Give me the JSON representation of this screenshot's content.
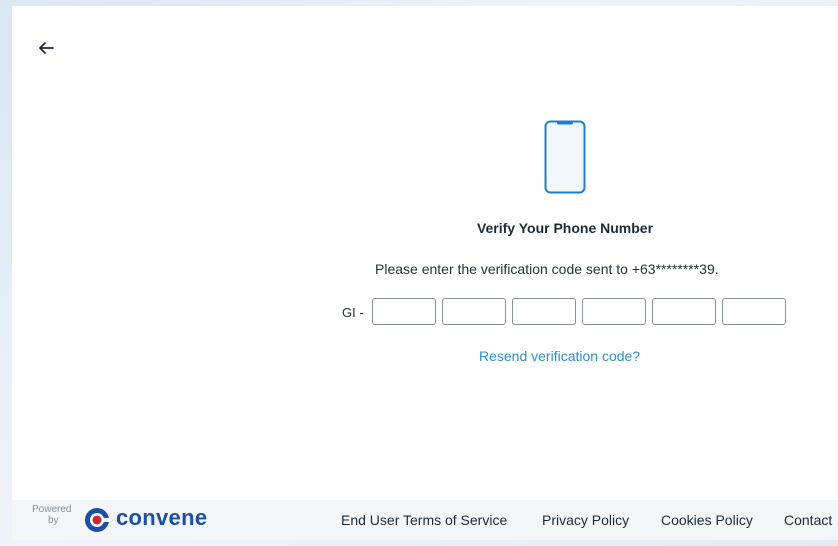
{
  "page": {
    "title": "Verify Your Phone Number",
    "instruction": "Please enter the verification code sent to +63********39.",
    "code_prefix": "GI -",
    "resend_label": "Resend verification code?"
  },
  "code_inputs": [
    "",
    "",
    "",
    "",
    "",
    ""
  ],
  "footer": {
    "powered": "Powered",
    "by": "by",
    "brand": "convene",
    "links": [
      "End User Terms of Service",
      "Privacy Policy",
      "Cookies Policy",
      "Contact"
    ]
  },
  "icons": {
    "back": "arrow-left-icon",
    "phone": "smartphone-icon",
    "logo": "convene-logo-icon"
  },
  "colors": {
    "accent": "#2b8fd6",
    "brand": "#1b4fa8",
    "logo_red": "#d0262f"
  }
}
